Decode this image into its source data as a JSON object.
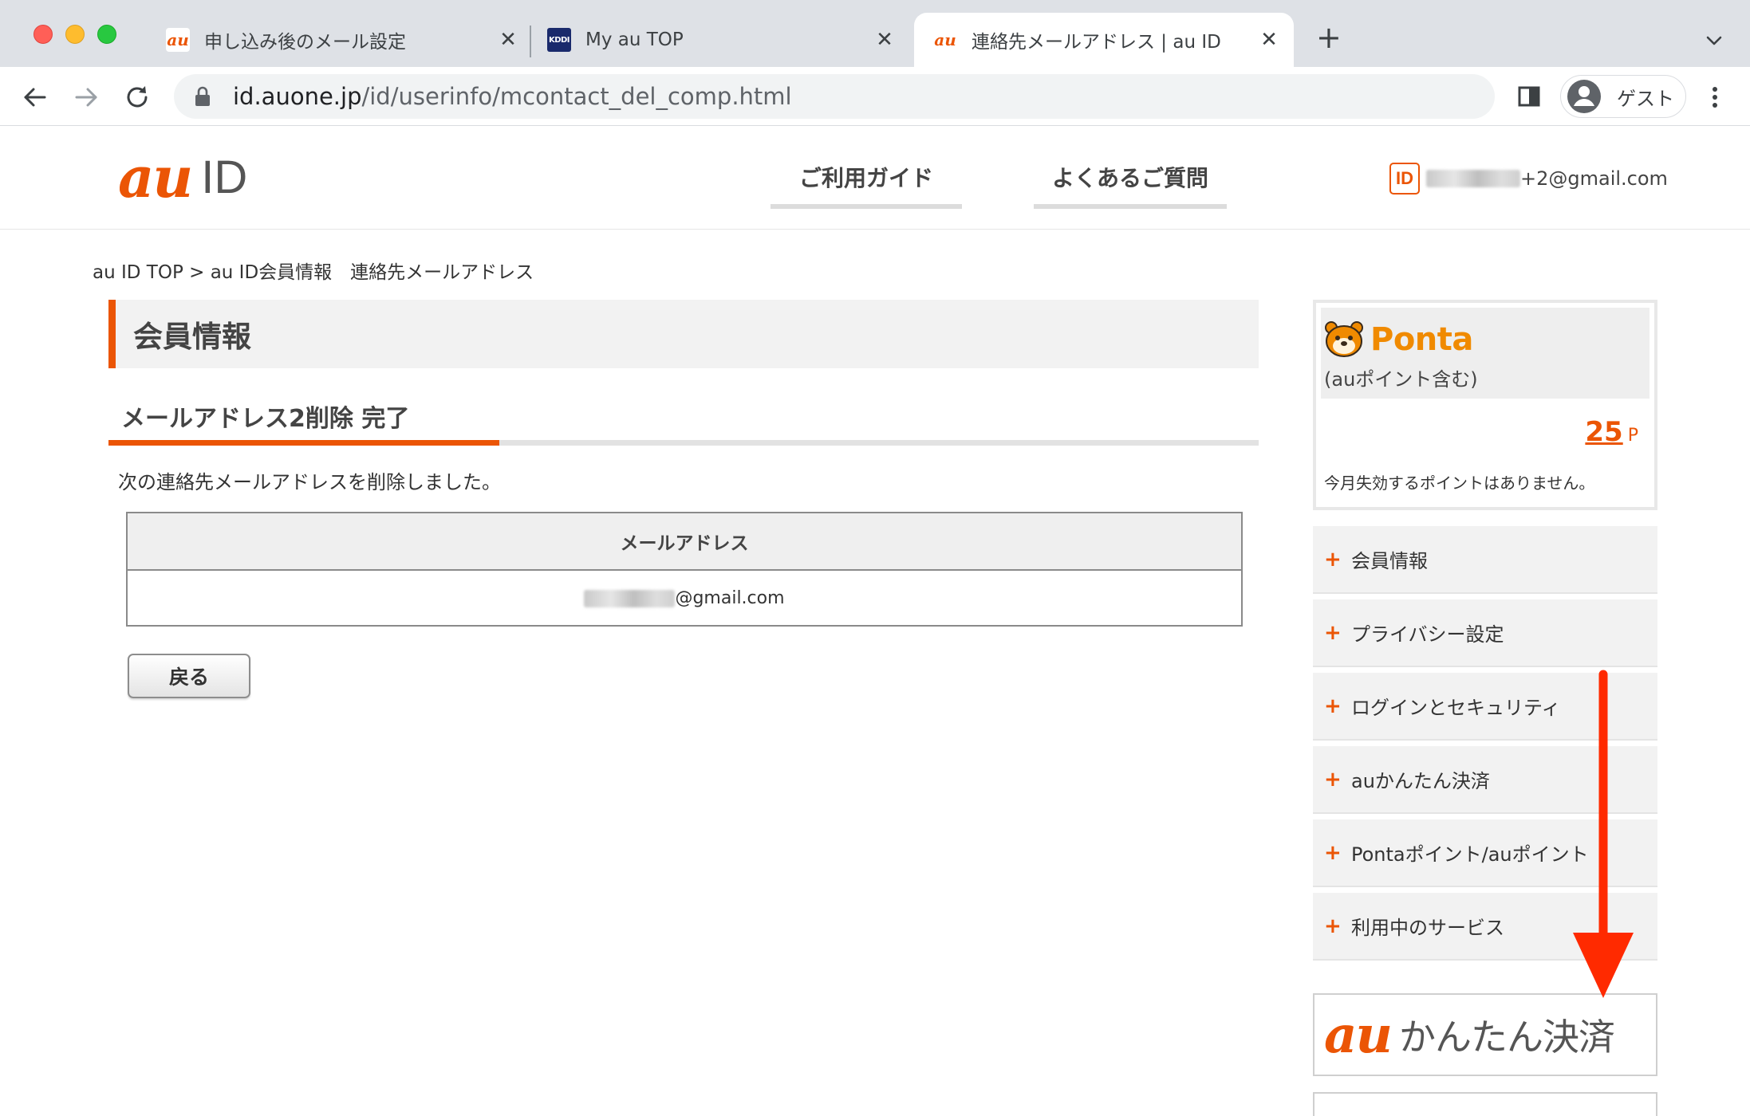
{
  "browser": {
    "tabs": [
      {
        "title": "申し込み後のメール設定",
        "favicon": "au-favicon"
      },
      {
        "title": "My au TOP",
        "favicon": "kddi-favicon"
      },
      {
        "title": "連絡先メールアドレス | au ID",
        "favicon": "au-favicon",
        "active": true
      }
    ],
    "favicon_text": {
      "au": "au",
      "kddi": "KDDI"
    },
    "url_host": "id.auone.jp",
    "url_path": "/id/userinfo/mcontact_del_comp.html",
    "profile_label": "ゲスト"
  },
  "header": {
    "logo_au": "au",
    "logo_id": "ID",
    "nav": {
      "guide": "ご利用ガイド",
      "faq": "よくあるご質問"
    },
    "id_badge": "ID",
    "user_email_suffix": "+2@gmail.com"
  },
  "breadcrumb": "au ID TOP > au ID会員情報　連絡先メールアドレス",
  "main": {
    "page_title": "会員情報",
    "section_title": "メールアドレス2削除 完了",
    "message": "次の連絡先メールアドレスを削除しました。",
    "table_header": "メールアドレス",
    "email_suffix": "@gmail.com",
    "back_button": "戻る"
  },
  "ponta": {
    "name": "Ponta",
    "subtitle": "(auポイント含む)",
    "points": "25",
    "unit": "P",
    "note": "今月失効するポイントはありません。"
  },
  "side_menu": [
    {
      "label": "会員情報"
    },
    {
      "label": "プライバシー設定"
    },
    {
      "label": "ログインとセキュリティ"
    },
    {
      "label": "auかんたん決済"
    },
    {
      "label": "Pontaポイント/auポイント"
    },
    {
      "label": "利用中のサービス"
    }
  ],
  "banner": {
    "au": "au",
    "text": "かんたん決済"
  },
  "colors": {
    "brand": "#eb5505",
    "ponta": "#f08a00",
    "arrow": "#ff2a00"
  }
}
